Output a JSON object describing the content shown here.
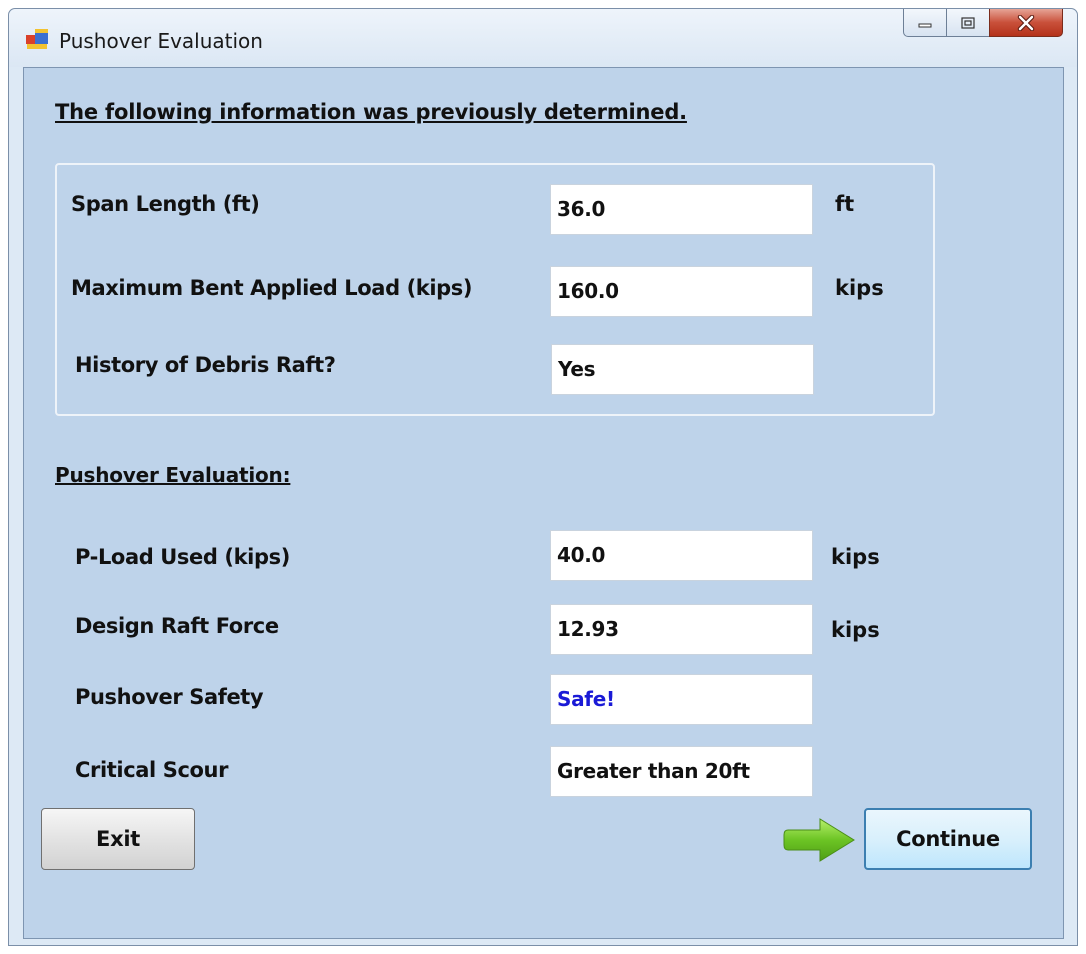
{
  "window": {
    "title": "Pushover Evaluation"
  },
  "previous": {
    "heading": "The following information was previously determined.",
    "rows": [
      {
        "label": "Span Length (ft)",
        "value": "36.0",
        "unit": "ft"
      },
      {
        "label": "Maximum Bent Applied Load (kips)",
        "value": "160.0",
        "unit": "kips"
      },
      {
        "label": "History of Debris Raft?",
        "value": "Yes",
        "unit": ""
      }
    ]
  },
  "evaluation": {
    "heading": "Pushover Evaluation:",
    "rows": [
      {
        "label": "P-Load Used (kips)",
        "value": "40.0",
        "unit": "kips"
      },
      {
        "label": "Design Raft Force",
        "value": "12.93",
        "unit": "kips"
      },
      {
        "label": "Pushover Safety",
        "value": "Safe!",
        "unit": ""
      },
      {
        "label": "Critical Scour",
        "value": "Greater than 20ft",
        "unit": ""
      }
    ]
  },
  "buttons": {
    "exit": "Exit",
    "continue": "Continue"
  },
  "colors": {
    "client_bg": "#bed3ea",
    "safe_text": "#1a1ad6",
    "arrow": "#6cc424"
  },
  "icons": {
    "app": "form-window-icon",
    "minimize": "minimize-icon",
    "maximize": "maximize-icon",
    "close": "close-icon",
    "arrow": "right-arrow-icon"
  }
}
